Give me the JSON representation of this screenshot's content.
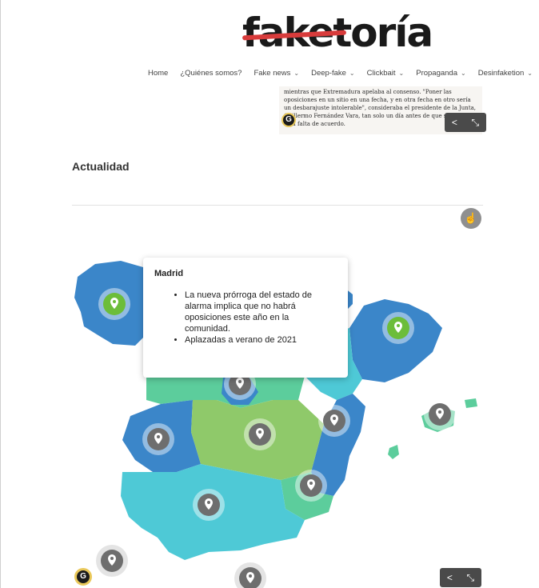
{
  "brand": {
    "logo_text": "faketoría",
    "accent": "#d83b3b"
  },
  "nav": [
    {
      "label": "Home",
      "dropdown": false
    },
    {
      "label": "¿Quiénes somos?",
      "dropdown": false
    },
    {
      "label": "Fake news",
      "dropdown": true
    },
    {
      "label": "Deep-fake",
      "dropdown": true
    },
    {
      "label": "Clickbait",
      "dropdown": true
    },
    {
      "label": "Propaganda",
      "dropdown": true
    },
    {
      "label": "Desinfaketion",
      "dropdown": true
    }
  ],
  "excerpt": {
    "text": "mientras que Extremadura apelaba al consenso. \"Poner las oposiciones en un sitio en una fecha, y en otra fecha en otro sería un desbarajuste intolerable\", consideraba el presidente de la Junta, Guillermo Fernández Vara, tan solo un día antes de que se hiciese esta falta de acuerdo."
  },
  "section": {
    "title": "Actualidad"
  },
  "tooltip": {
    "title": "Madrid",
    "items": [
      "La nueva prórroga del estado de alarma implica que no habrá oposiciones este año en la comunidad.",
      "Aplazadas a verano de 2021"
    ]
  },
  "icons": {
    "share": "share-icon",
    "expand": "expand-icon",
    "hand": "hand-pointer-icon",
    "pin": "map-pin-icon"
  },
  "colors": {
    "region_blue": "#3b86c9",
    "region_teal": "#4ec9d6",
    "region_green": "#8fc96a",
    "region_mint": "#5ccd9c",
    "pin_active": "#6cbd3a",
    "pin_inactive": "#6e6e6e"
  },
  "controls": {
    "share_glyph": "<",
    "expand_glyph": "⤡"
  }
}
